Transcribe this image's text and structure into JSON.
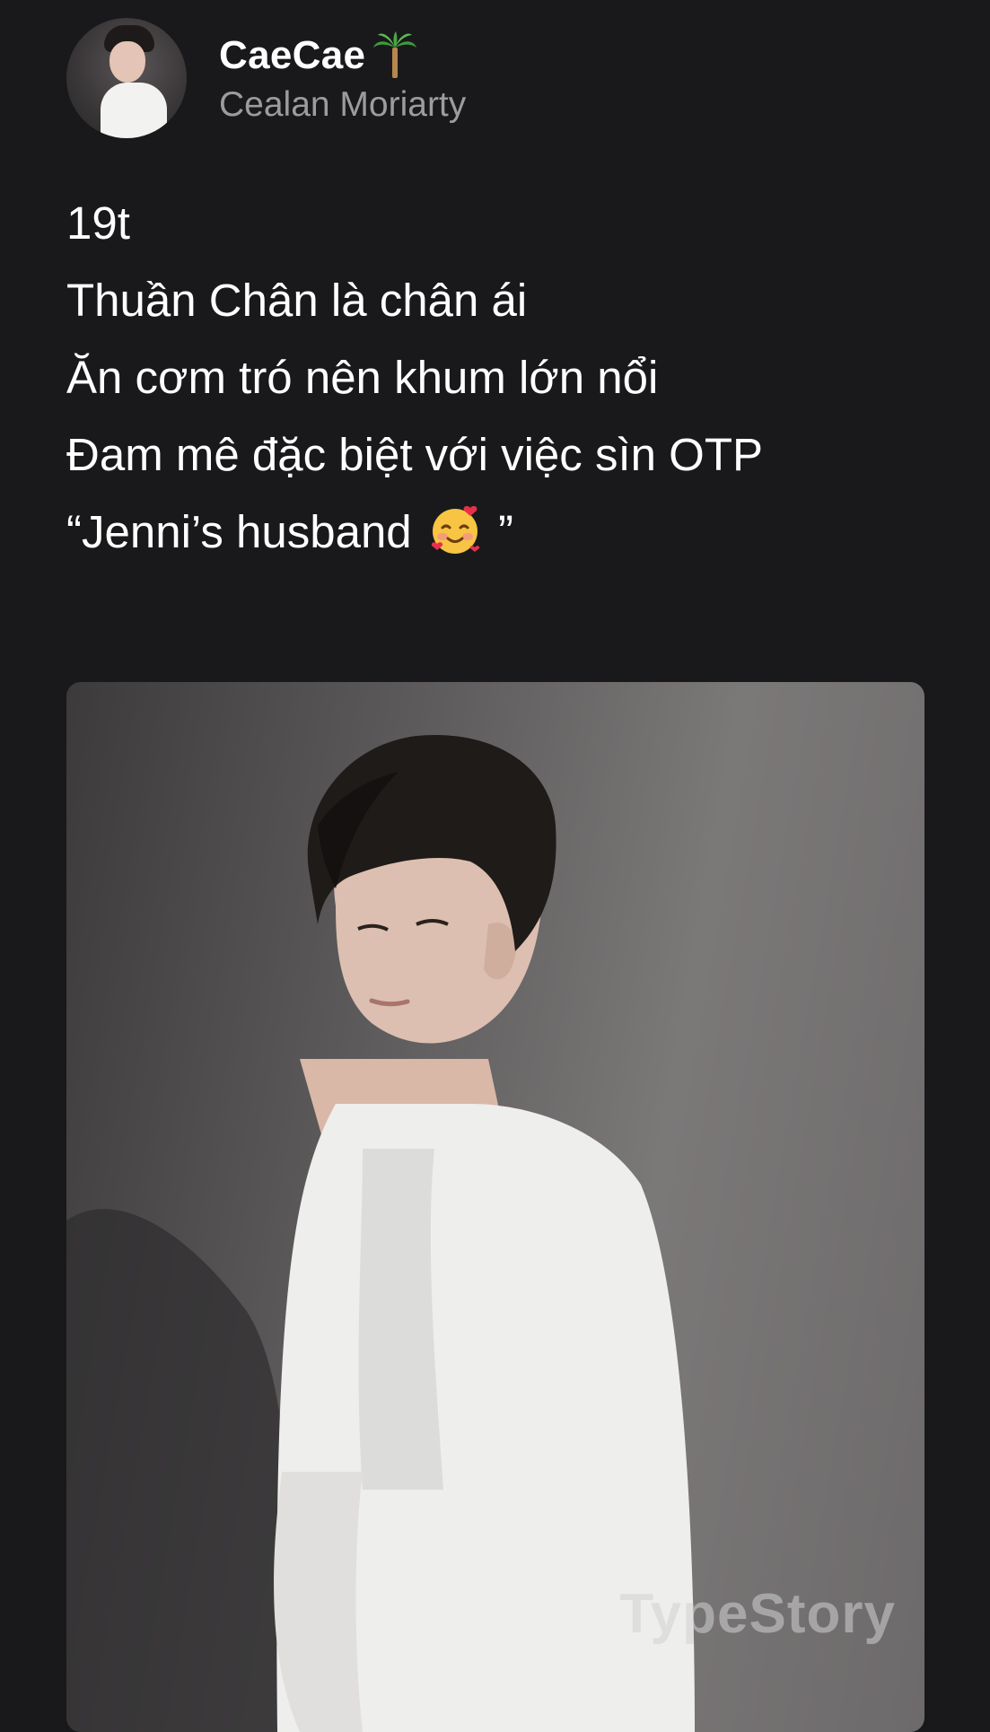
{
  "profile": {
    "display_name": "CaeCae",
    "name_emoji": "palm-tree-icon",
    "username": "Cealan Moriarty",
    "avatar": "avatar"
  },
  "bio": {
    "line1": "19t",
    "line2": "Thuần Chân là chân ái",
    "line3": "Ăn cơm tró nên khum lớn nổi",
    "line4": "Đam mê đặc biệt với việc sìn OTP",
    "line5_prefix": "“Jenni’s husband",
    "line5_emoji": "smiling-face-with-hearts-icon",
    "line5_suffix": "”"
  },
  "photo": {
    "watermark": "TypeStory"
  },
  "colors": {
    "background": "#19191c",
    "text_primary": "#ffffff",
    "text_secondary": "#9c9c9f"
  }
}
